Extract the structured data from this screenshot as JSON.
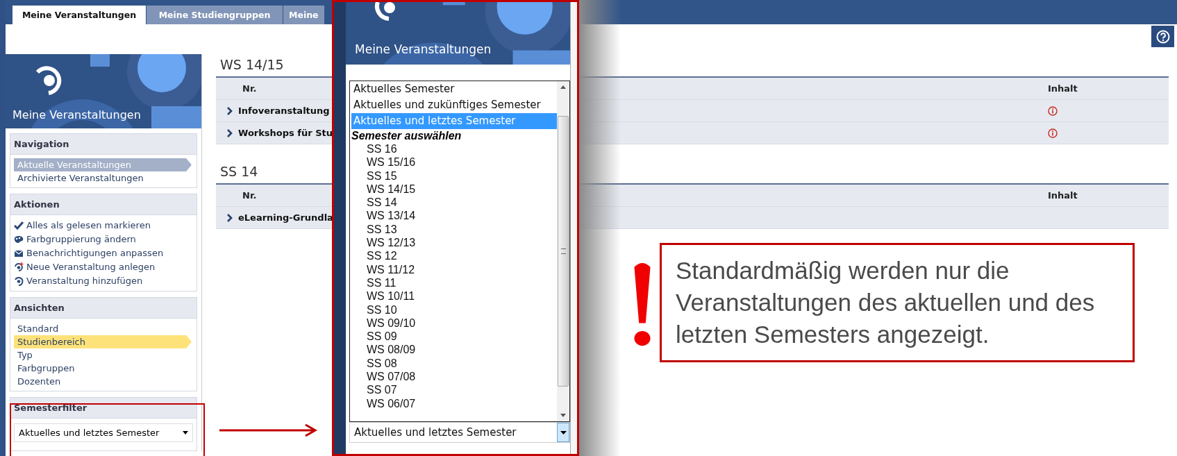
{
  "tabs": [
    {
      "label": "Meine Veranstaltungen",
      "selected": true
    },
    {
      "label": "Meine Studiengruppen",
      "selected": false
    },
    {
      "label": "Meine",
      "selected": false
    }
  ],
  "sidebar": {
    "header_title": "Meine Veranstaltungen",
    "sections": [
      {
        "kind": "navigation",
        "title": "Navigation",
        "items": [
          {
            "label": "Aktuelle Veranstaltungen",
            "selected": true
          },
          {
            "label": "Archivierte Veranstaltungen",
            "selected": false
          }
        ]
      },
      {
        "kind": "actions",
        "title": "Aktionen",
        "items": [
          {
            "label": "Alles als gelesen markieren",
            "kind": "check"
          },
          {
            "label": "Farbgruppierung ändern",
            "kind": "palette"
          },
          {
            "label": "Benachrichtigungen anpassen",
            "kind": "mail"
          },
          {
            "label": "Neue Veranstaltung anlegen",
            "kind": "new"
          },
          {
            "label": "Veranstaltung hinzufügen",
            "kind": "add"
          }
        ]
      },
      {
        "kind": "views",
        "title": "Ansichten",
        "items": [
          {
            "label": "Standard",
            "selected": false
          },
          {
            "label": "Studienbereich",
            "selected": true
          },
          {
            "label": "Typ",
            "selected": false
          },
          {
            "label": "Farbgruppen",
            "selected": false
          },
          {
            "label": "Dozenten",
            "selected": false
          }
        ]
      }
    ],
    "semester_filter": {
      "title": "Semesterfilter",
      "value": "Aktuelles und letztes Semester"
    }
  },
  "content": {
    "groups": [
      {
        "title": "WS 14/15",
        "columns": [
          "Nr.",
          "Inhalt"
        ],
        "rows": [
          {
            "title": "Infoveranstaltung",
            "info": true
          },
          {
            "title": "Workshops für Stu",
            "info": true
          }
        ]
      },
      {
        "title": "SS 14",
        "columns": [
          "Nr.",
          "Inhalt"
        ],
        "rows": [
          {
            "title": "eLearning-Grundla",
            "info": false
          }
        ]
      }
    ]
  },
  "zoom_popup": {
    "header_title": "Meine Veranstaltungen",
    "options": [
      {
        "label": "Aktuelles Semester",
        "selected": false
      },
      {
        "label": "Aktuelles und zukünftiges Semester",
        "selected": false
      },
      {
        "label": "Aktuelles und letztes Semester",
        "selected": true
      }
    ],
    "group_label": "Semester auswählen",
    "semesters": [
      "SS 16",
      "WS 15/16",
      "SS 15",
      "WS 14/15",
      "SS 14",
      "WS 13/14",
      "SS 13",
      "WS 12/13",
      "SS 12",
      "WS 11/12",
      "SS 11",
      "WS 10/11",
      "SS 10",
      "WS 09/10",
      "SS 09",
      "WS 08/09",
      "SS 08",
      "WS 07/08",
      "SS 07",
      "WS 06/07"
    ],
    "value": "Aktuelles und letztes Semester"
  },
  "note": {
    "text": "Standardmäßig werden nur die Veranstaltungen des aktuellen und des letzten Semesters angezeigt."
  }
}
